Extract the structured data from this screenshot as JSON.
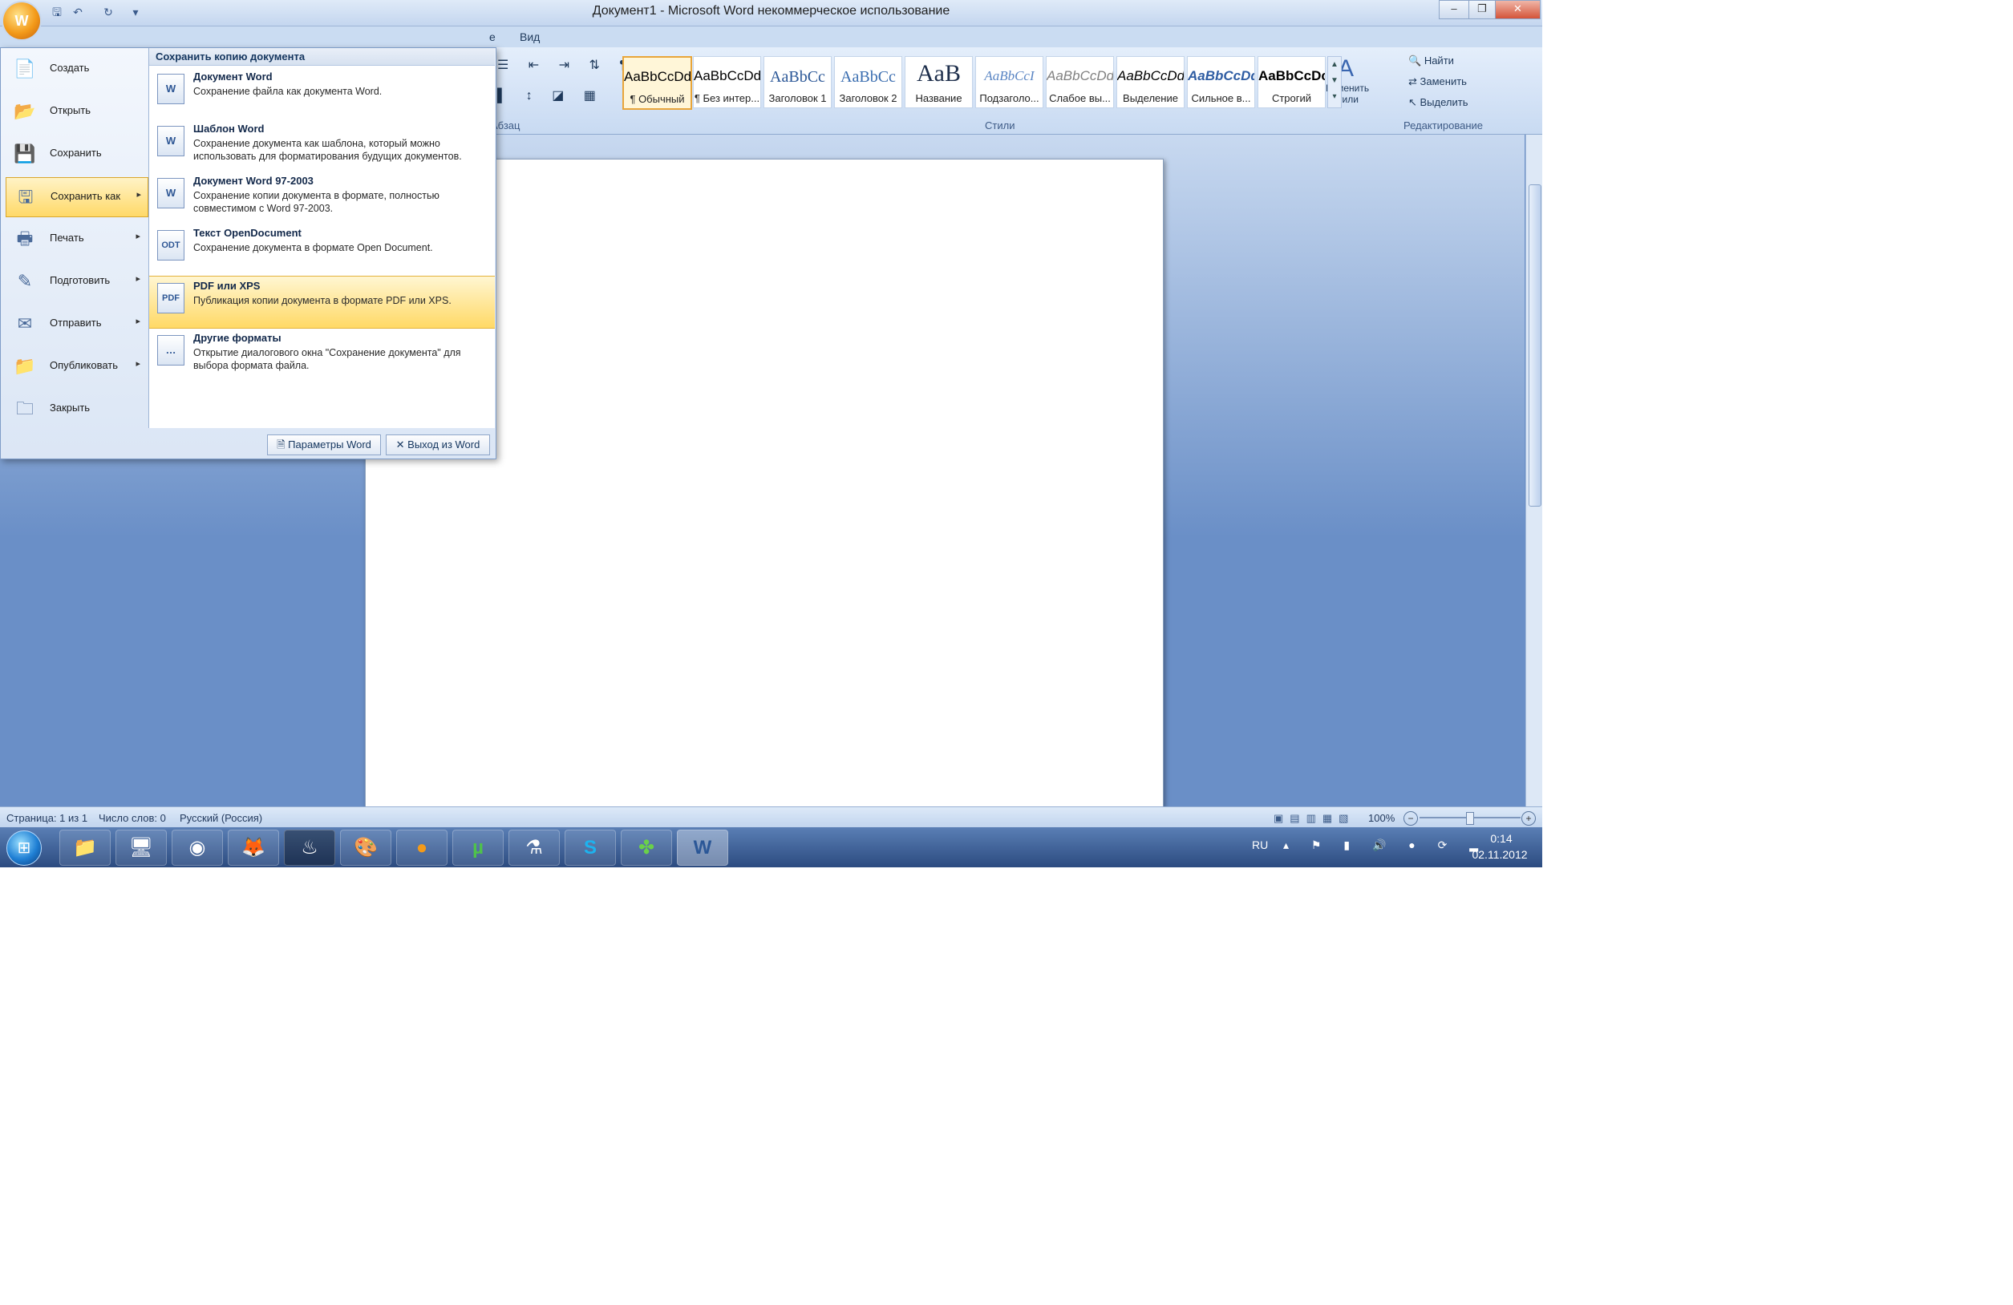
{
  "window": {
    "title": "Документ1 - Microsoft Word некоммерческое использование",
    "minimize": "–",
    "maximize": "❐",
    "close": "✕"
  },
  "quick_access": {
    "office_button": "W",
    "save_icon": "floppy-icon",
    "undo": "↶",
    "redo": "↻",
    "customize": "▾"
  },
  "ribbon": {
    "tabs": [
      {
        "label": "е"
      },
      {
        "label": "Вид"
      }
    ],
    "groups": {
      "paragraph": "Абзац",
      "styles": "Стили",
      "editing": "Редактирование"
    },
    "styles": [
      {
        "sample": "AaBbCcDd",
        "name": "¶ Обычный"
      },
      {
        "sample": "AaBbCcDd",
        "name": "¶ Без интер..."
      },
      {
        "sample": "AaBbCc",
        "name": "Заголовок 1"
      },
      {
        "sample": "AaBbCc",
        "name": "Заголовок 2"
      },
      {
        "sample": "AaB",
        "name": "Название"
      },
      {
        "sample": "AaBbCcI",
        "name": "Подзаголо..."
      },
      {
        "sample": "AaBbCcDd",
        "name": "Слабое вы..."
      },
      {
        "sample": "AaBbCcDd",
        "name": "Выделение"
      },
      {
        "sample": "AaBbCcDd",
        "name": "Сильное в..."
      },
      {
        "sample": "AaBbCcDc",
        "name": "Строгий"
      }
    ],
    "change_styles": "Изменить стили",
    "editing": [
      {
        "label": "Найти"
      },
      {
        "label": "Заменить"
      },
      {
        "label": "Выделить"
      }
    ]
  },
  "office_menu": {
    "items": [
      {
        "label": "Создать",
        "icon": "📄"
      },
      {
        "label": "Открыть",
        "icon": "📂"
      },
      {
        "label": "Сохранить",
        "icon": "💾"
      },
      {
        "label": "Сохранить как",
        "icon": "🖫",
        "arrow": "▸"
      },
      {
        "label": "Печать",
        "icon": "🖶",
        "arrow": "▸"
      },
      {
        "label": "Подготовить",
        "icon": "✎",
        "arrow": "▸"
      },
      {
        "label": "Отправить",
        "icon": "✉",
        "arrow": "▸"
      },
      {
        "label": "Опубликовать",
        "icon": "📁",
        "arrow": "▸"
      },
      {
        "label": "Закрыть",
        "icon": "🗀"
      }
    ],
    "submenu": {
      "header": "Сохранить копию документа",
      "items": [
        {
          "title": "Документ Word",
          "desc": "Сохранение файла как документа Word.",
          "icon": "W"
        },
        {
          "title": "Шаблон Word",
          "desc": "Сохранение документа как шаблона, который можно использовать для форматирования будущих документов.",
          "icon": "W"
        },
        {
          "title": "Документ Word 97-2003",
          "desc": "Сохранение копии документа в формате, полностью совместимом с Word 97-2003.",
          "icon": "W"
        },
        {
          "title": "Текст OpenDocument",
          "desc": "Сохранение документа в формате Open Document.",
          "icon": "ODT"
        },
        {
          "title": "PDF или XPS",
          "desc": "Публикация копии документа в формате PDF или XPS.",
          "icon": "PDF"
        },
        {
          "title": "Другие форматы",
          "desc": "Открытие диалогового окна \"Сохранение документа\" для выбора формата файла.",
          "icon": "…"
        }
      ]
    },
    "footer": {
      "options": "Параметры Word",
      "exit": "Выход из Word"
    }
  },
  "statusbar": {
    "page": "Страница: 1 из 1",
    "words": "Число слов: 0",
    "language": "Русский (Россия)",
    "zoom": "100%"
  },
  "taskbar": {
    "language": "RU",
    "time": "0:14",
    "date": "02.11.2012",
    "apps": [
      {
        "name": "explorer",
        "glyph": "📁"
      },
      {
        "name": "computer",
        "glyph": "🖥"
      },
      {
        "name": "chrome",
        "glyph": "◉"
      },
      {
        "name": "firefox",
        "glyph": "🦊"
      },
      {
        "name": "steam",
        "glyph": "♨"
      },
      {
        "name": "paint",
        "glyph": "🎨"
      },
      {
        "name": "browser",
        "glyph": "●"
      },
      {
        "name": "utorrent",
        "glyph": "µ"
      },
      {
        "name": "app",
        "glyph": "⚗"
      },
      {
        "name": "skype",
        "glyph": "S"
      },
      {
        "name": "clover",
        "glyph": "✤"
      },
      {
        "name": "word",
        "glyph": "W"
      }
    ]
  }
}
